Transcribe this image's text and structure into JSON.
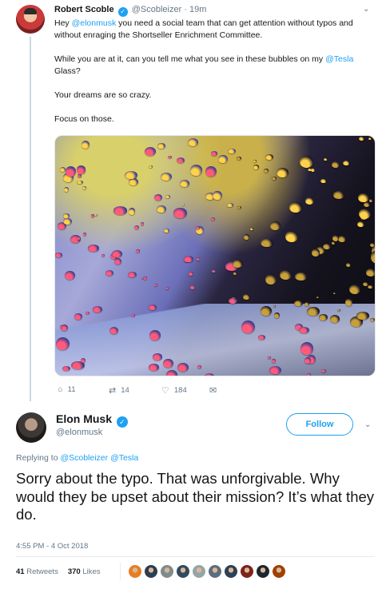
{
  "reply_context": {
    "author_name": "Robert Scoble",
    "author_handle": "@Scobleizer",
    "time": "19m",
    "body": {
      "p1_prefix": "Hey ",
      "p1_mention": "@elonmusk",
      "p1_rest": " you need a social team that can get attention without typos and without enraging the Shortseller Enrichment Committee.",
      "p2_prefix": "While you are at it, can you tell me what you see in these bubbles on my ",
      "p2_mention": "@Tesla",
      "p2_rest": " Glass?",
      "p3": "Your dreams are so crazy.",
      "p4": "Focus on those."
    },
    "actions": {
      "replies": "11",
      "retweets": "14",
      "likes": "184"
    }
  },
  "tweet": {
    "author_name": "Elon Musk",
    "author_handle": "@elonmusk",
    "follow_label": "Follow",
    "replying_prefix": "Replying to ",
    "replying_to_1": "@Scobleizer",
    "replying_to_2": "@Tesla",
    "text": "Sorry about the typo. That was unforgivable. Why would they be upset about their mission? It’s what they do.",
    "timestamp": "4:55 PM - 4 Oct 2018",
    "retweets_count": "41",
    "retweets_label": "Retweets",
    "likes_count": "370",
    "likes_label": "Likes"
  },
  "icons": {
    "reply": "reply-icon",
    "retweet": "retweet-icon",
    "like": "heart-icon",
    "message": "envelope-icon",
    "verified": "verified-badge-icon",
    "more": "chevron-down-icon"
  },
  "colors": {
    "accent": "#1da1f2",
    "muted": "#657786",
    "text": "#14171a"
  }
}
